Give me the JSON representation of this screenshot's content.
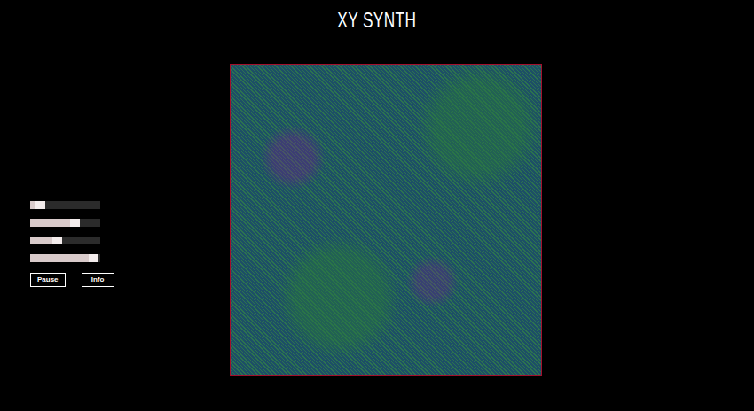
{
  "title": "XY SYNTH",
  "sliders": [
    {
      "level": 0.22
    },
    {
      "level": 0.71
    },
    {
      "level": 0.46
    },
    {
      "level": 0.97
    }
  ],
  "buttons": [
    "Pause",
    "Info"
  ]
}
